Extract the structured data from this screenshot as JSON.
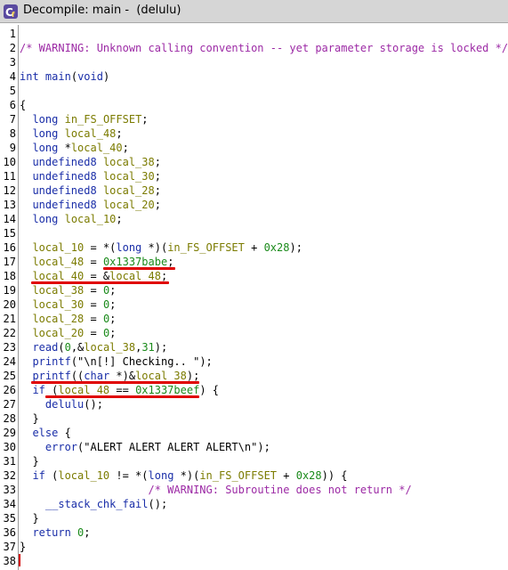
{
  "window": {
    "title": "Decompile: main -  (delulu)",
    "icon": "ghidra-decompiler-icon"
  },
  "colors": {
    "comment": "#9c2aa5",
    "type": "#1a2ea8",
    "variable": "#7b7b00",
    "function": "#1a2ea8",
    "number": "#1a8a1a",
    "annotation": "#e00000"
  },
  "lines": [
    {
      "n": "1",
      "tokens": []
    },
    {
      "n": "2",
      "tokens": [
        {
          "t": "/* WARNING: Unknown calling convention -- yet parameter storage is locked */",
          "c": "comment"
        }
      ]
    },
    {
      "n": "3",
      "tokens": []
    },
    {
      "n": "4",
      "tokens": [
        {
          "t": "int",
          "c": "type"
        },
        {
          "t": " ",
          "c": "plain"
        },
        {
          "t": "main",
          "c": "fn"
        },
        {
          "t": "(",
          "c": "plain"
        },
        {
          "t": "void",
          "c": "type"
        },
        {
          "t": ")",
          "c": "plain"
        }
      ]
    },
    {
      "n": "5",
      "tokens": []
    },
    {
      "n": "6",
      "tokens": [
        {
          "t": "{",
          "c": "plain"
        }
      ]
    },
    {
      "n": "7",
      "tokens": [
        {
          "t": "  ",
          "c": "plain"
        },
        {
          "t": "long",
          "c": "type"
        },
        {
          "t": " ",
          "c": "plain"
        },
        {
          "t": "in_FS_OFFSET",
          "c": "var"
        },
        {
          "t": ";",
          "c": "plain"
        }
      ]
    },
    {
      "n": "8",
      "tokens": [
        {
          "t": "  ",
          "c": "plain"
        },
        {
          "t": "long",
          "c": "type"
        },
        {
          "t": " ",
          "c": "plain"
        },
        {
          "t": "local_48",
          "c": "var"
        },
        {
          "t": ";",
          "c": "plain"
        }
      ]
    },
    {
      "n": "9",
      "tokens": [
        {
          "t": "  ",
          "c": "plain"
        },
        {
          "t": "long",
          "c": "type"
        },
        {
          "t": " *",
          "c": "plain"
        },
        {
          "t": "local_40",
          "c": "var"
        },
        {
          "t": ";",
          "c": "plain"
        }
      ]
    },
    {
      "n": "10",
      "tokens": [
        {
          "t": "  ",
          "c": "plain"
        },
        {
          "t": "undefined8",
          "c": "type"
        },
        {
          "t": " ",
          "c": "plain"
        },
        {
          "t": "local_38",
          "c": "var"
        },
        {
          "t": ";",
          "c": "plain"
        }
      ]
    },
    {
      "n": "11",
      "tokens": [
        {
          "t": "  ",
          "c": "plain"
        },
        {
          "t": "undefined8",
          "c": "type"
        },
        {
          "t": " ",
          "c": "plain"
        },
        {
          "t": "local_30",
          "c": "var"
        },
        {
          "t": ";",
          "c": "plain"
        }
      ]
    },
    {
      "n": "12",
      "tokens": [
        {
          "t": "  ",
          "c": "plain"
        },
        {
          "t": "undefined8",
          "c": "type"
        },
        {
          "t": " ",
          "c": "plain"
        },
        {
          "t": "local_28",
          "c": "var"
        },
        {
          "t": ";",
          "c": "plain"
        }
      ]
    },
    {
      "n": "13",
      "tokens": [
        {
          "t": "  ",
          "c": "plain"
        },
        {
          "t": "undefined8",
          "c": "type"
        },
        {
          "t": " ",
          "c": "plain"
        },
        {
          "t": "local_20",
          "c": "var"
        },
        {
          "t": ";",
          "c": "plain"
        }
      ]
    },
    {
      "n": "14",
      "tokens": [
        {
          "t": "  ",
          "c": "plain"
        },
        {
          "t": "long",
          "c": "type"
        },
        {
          "t": " ",
          "c": "plain"
        },
        {
          "t": "local_10",
          "c": "var"
        },
        {
          "t": ";",
          "c": "plain"
        }
      ]
    },
    {
      "n": "15",
      "tokens": []
    },
    {
      "n": "16",
      "tokens": [
        {
          "t": "  ",
          "c": "plain"
        },
        {
          "t": "local_10",
          "c": "var"
        },
        {
          "t": " = *(",
          "c": "plain"
        },
        {
          "t": "long",
          "c": "type"
        },
        {
          "t": " *)(",
          "c": "plain"
        },
        {
          "t": "in_FS_OFFSET",
          "c": "var"
        },
        {
          "t": " + ",
          "c": "plain"
        },
        {
          "t": "0x28",
          "c": "num"
        },
        {
          "t": ");",
          "c": "plain"
        }
      ]
    },
    {
      "n": "17",
      "tokens": [
        {
          "t": "  ",
          "c": "plain"
        },
        {
          "t": "local_48",
          "c": "var"
        },
        {
          "t": " = ",
          "c": "plain"
        },
        {
          "t": "0x1337babe",
          "c": "num"
        },
        {
          "t": ";",
          "c": "plain"
        }
      ]
    },
    {
      "n": "18",
      "tokens": [
        {
          "t": "  ",
          "c": "plain"
        },
        {
          "t": "local_40",
          "c": "var"
        },
        {
          "t": " = &",
          "c": "plain"
        },
        {
          "t": "local_48",
          "c": "var"
        },
        {
          "t": ";",
          "c": "plain"
        }
      ]
    },
    {
      "n": "19",
      "tokens": [
        {
          "t": "  ",
          "c": "plain"
        },
        {
          "t": "local_38",
          "c": "var"
        },
        {
          "t": " = ",
          "c": "plain"
        },
        {
          "t": "0",
          "c": "num"
        },
        {
          "t": ";",
          "c": "plain"
        }
      ]
    },
    {
      "n": "20",
      "tokens": [
        {
          "t": "  ",
          "c": "plain"
        },
        {
          "t": "local_30",
          "c": "var"
        },
        {
          "t": " = ",
          "c": "plain"
        },
        {
          "t": "0",
          "c": "num"
        },
        {
          "t": ";",
          "c": "plain"
        }
      ]
    },
    {
      "n": "21",
      "tokens": [
        {
          "t": "  ",
          "c": "plain"
        },
        {
          "t": "local_28",
          "c": "var"
        },
        {
          "t": " = ",
          "c": "plain"
        },
        {
          "t": "0",
          "c": "num"
        },
        {
          "t": ";",
          "c": "plain"
        }
      ]
    },
    {
      "n": "22",
      "tokens": [
        {
          "t": "  ",
          "c": "plain"
        },
        {
          "t": "local_20",
          "c": "var"
        },
        {
          "t": " = ",
          "c": "plain"
        },
        {
          "t": "0",
          "c": "num"
        },
        {
          "t": ";",
          "c": "plain"
        }
      ]
    },
    {
      "n": "23",
      "tokens": [
        {
          "t": "  ",
          "c": "plain"
        },
        {
          "t": "read",
          "c": "fn"
        },
        {
          "t": "(",
          "c": "plain"
        },
        {
          "t": "0",
          "c": "num"
        },
        {
          "t": ",&",
          "c": "plain"
        },
        {
          "t": "local_38",
          "c": "var"
        },
        {
          "t": ",",
          "c": "plain"
        },
        {
          "t": "31",
          "c": "num"
        },
        {
          "t": ");",
          "c": "plain"
        }
      ]
    },
    {
      "n": "24",
      "tokens": [
        {
          "t": "  ",
          "c": "plain"
        },
        {
          "t": "printf",
          "c": "fn"
        },
        {
          "t": "(",
          "c": "plain"
        },
        {
          "t": "\"\\n[!] Checking.. \"",
          "c": "plain"
        },
        {
          "t": ");",
          "c": "plain"
        }
      ]
    },
    {
      "n": "25",
      "tokens": [
        {
          "t": "  ",
          "c": "plain"
        },
        {
          "t": "printf",
          "c": "fn"
        },
        {
          "t": "((",
          "c": "plain"
        },
        {
          "t": "char",
          "c": "type"
        },
        {
          "t": " *)&",
          "c": "plain"
        },
        {
          "t": "local_38",
          "c": "var"
        },
        {
          "t": ");",
          "c": "plain"
        }
      ]
    },
    {
      "n": "26",
      "tokens": [
        {
          "t": "  ",
          "c": "plain"
        },
        {
          "t": "if",
          "c": "kw"
        },
        {
          "t": " (",
          "c": "plain"
        },
        {
          "t": "local_48",
          "c": "var"
        },
        {
          "t": " == ",
          "c": "plain"
        },
        {
          "t": "0x1337beef",
          "c": "num"
        },
        {
          "t": ") {",
          "c": "plain"
        }
      ]
    },
    {
      "n": "27",
      "tokens": [
        {
          "t": "    ",
          "c": "plain"
        },
        {
          "t": "delulu",
          "c": "fn"
        },
        {
          "t": "();",
          "c": "plain"
        }
      ]
    },
    {
      "n": "28",
      "tokens": [
        {
          "t": "  }",
          "c": "plain"
        }
      ]
    },
    {
      "n": "29",
      "tokens": [
        {
          "t": "  ",
          "c": "plain"
        },
        {
          "t": "else",
          "c": "kw"
        },
        {
          "t": " {",
          "c": "plain"
        }
      ]
    },
    {
      "n": "30",
      "tokens": [
        {
          "t": "    ",
          "c": "plain"
        },
        {
          "t": "error",
          "c": "fn"
        },
        {
          "t": "(",
          "c": "plain"
        },
        {
          "t": "\"ALERT ALERT ALERT ALERT\\n\"",
          "c": "plain"
        },
        {
          "t": ");",
          "c": "plain"
        }
      ]
    },
    {
      "n": "31",
      "tokens": [
        {
          "t": "  }",
          "c": "plain"
        }
      ]
    },
    {
      "n": "32",
      "tokens": [
        {
          "t": "  ",
          "c": "plain"
        },
        {
          "t": "if",
          "c": "kw"
        },
        {
          "t": " (",
          "c": "plain"
        },
        {
          "t": "local_10",
          "c": "var"
        },
        {
          "t": " != *(",
          "c": "plain"
        },
        {
          "t": "long",
          "c": "type"
        },
        {
          "t": " *)(",
          "c": "plain"
        },
        {
          "t": "in_FS_OFFSET",
          "c": "var"
        },
        {
          "t": " + ",
          "c": "plain"
        },
        {
          "t": "0x28",
          "c": "num"
        },
        {
          "t": ")) {",
          "c": "plain"
        }
      ]
    },
    {
      "n": "33",
      "tokens": [
        {
          "t": "                    ",
          "c": "plain"
        },
        {
          "t": "/* WARNING: Subroutine does not return */",
          "c": "comment"
        }
      ]
    },
    {
      "n": "34",
      "tokens": [
        {
          "t": "    ",
          "c": "plain"
        },
        {
          "t": "__stack_chk_fail",
          "c": "fn"
        },
        {
          "t": "();",
          "c": "plain"
        }
      ]
    },
    {
      "n": "35",
      "tokens": [
        {
          "t": "  }",
          "c": "plain"
        }
      ]
    },
    {
      "n": "36",
      "tokens": [
        {
          "t": "  ",
          "c": "plain"
        },
        {
          "t": "return",
          "c": "kw"
        },
        {
          "t": " ",
          "c": "plain"
        },
        {
          "t": "0",
          "c": "num"
        },
        {
          "t": ";",
          "c": "plain"
        }
      ]
    },
    {
      "n": "37",
      "tokens": [
        {
          "t": "}",
          "c": "plain"
        }
      ]
    },
    {
      "n": "38",
      "tokens": []
    }
  ]
}
